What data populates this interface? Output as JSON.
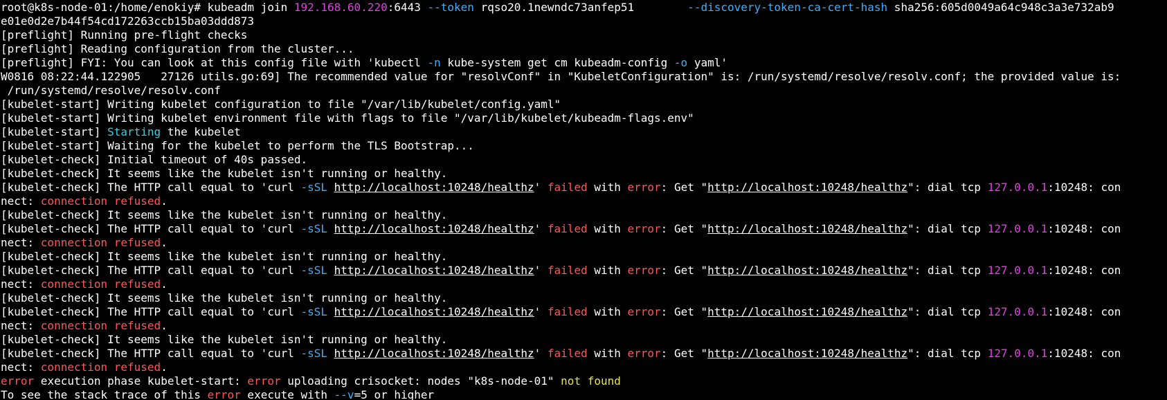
{
  "terminal": {
    "lines": [
      {
        "segs": [
          {
            "t": "root@k8s-node-01:/home/enokiy# kubeadm join ",
            "c": "p"
          },
          {
            "t": "192.168.60.220",
            "c": "m"
          },
          {
            "t": ":6443 ",
            "c": "p"
          },
          {
            "t": "--token",
            "c": "c"
          },
          {
            "t": " rqso20.1newndc73anfep51        ",
            "c": "p"
          },
          {
            "t": "--discovery-token-ca-cert-hash",
            "c": "c"
          },
          {
            "t": " sha256:605d0049a64c948c3a3e732ab9",
            "c": "p"
          }
        ]
      },
      {
        "segs": [
          {
            "t": "e01e0d2e7b44f54cd172263ccb15ba03ddd873",
            "c": "p"
          }
        ]
      },
      {
        "segs": [
          {
            "t": "[preflight] Running pre-flight checks",
            "c": "p"
          }
        ]
      },
      {
        "segs": [
          {
            "t": "[preflight] Reading configuration from the cluster...",
            "c": "p"
          }
        ]
      },
      {
        "segs": [
          {
            "t": "[preflight] FYI: You can look at this config file with 'kubectl ",
            "c": "p"
          },
          {
            "t": "-n",
            "c": "c"
          },
          {
            "t": " kube-system get cm kubeadm-config ",
            "c": "p"
          },
          {
            "t": "-o",
            "c": "c"
          },
          {
            "t": " yaml'",
            "c": "p"
          }
        ]
      },
      {
        "segs": [
          {
            "t": "W0816 08:22:44.122905   27126 utils.go:69] The recommended value for \"resolvConf\" in \"KubeletConfiguration\" is: /run/systemd/resolve/resolv.conf; the provided value is:",
            "c": "p"
          }
        ]
      },
      {
        "segs": [
          {
            "t": " /run/systemd/resolve/resolv.conf",
            "c": "p"
          }
        ]
      },
      {
        "segs": [
          {
            "t": "[kubelet-start] Writing kubelet configuration to file \"/var/lib/kubelet/config.yaml\"",
            "c": "p"
          }
        ]
      },
      {
        "segs": [
          {
            "t": "[kubelet-start] Writing kubelet environment file with flags to file \"/var/lib/kubelet/kubeadm-flags.env\"",
            "c": "p"
          }
        ]
      },
      {
        "segs": [
          {
            "t": "[kubelet-start] ",
            "c": "p"
          },
          {
            "t": "Starting",
            "c": "t"
          },
          {
            "t": " the kubelet",
            "c": "p"
          }
        ]
      },
      {
        "segs": [
          {
            "t": "[kubelet-start] Waiting for the kubelet to perform the TLS Bootstrap...",
            "c": "p"
          }
        ]
      },
      {
        "segs": [
          {
            "t": "[kubelet-check] Initial timeout of 40s passed.",
            "c": "p"
          }
        ]
      },
      {
        "segs": [
          {
            "t": "[kubelet-check] It seems like the kubelet isn't running or healthy.",
            "c": "p"
          }
        ]
      },
      {
        "segs": [
          {
            "t": "[kubelet-check] The HTTP call equal to 'curl ",
            "c": "p"
          },
          {
            "t": "-sSL",
            "c": "c"
          },
          {
            "t": " ",
            "c": "p"
          },
          {
            "t": "http://localhost:10248/healthz",
            "c": "u"
          },
          {
            "t": "' ",
            "c": "p"
          },
          {
            "t": "failed",
            "c": "r"
          },
          {
            "t": " with ",
            "c": "p"
          },
          {
            "t": "error",
            "c": "r"
          },
          {
            "t": ": Get \"",
            "c": "p"
          },
          {
            "t": "http://localhost:10248/healthz",
            "c": "u"
          },
          {
            "t": "\": dial tcp ",
            "c": "p"
          },
          {
            "t": "127.0.0.1",
            "c": "m"
          },
          {
            "t": ":10248: con",
            "c": "p"
          }
        ]
      },
      {
        "segs": [
          {
            "t": "nect: ",
            "c": "p"
          },
          {
            "t": "connection refused",
            "c": "r"
          },
          {
            "t": ".",
            "c": "p"
          }
        ]
      },
      {
        "segs": [
          {
            "t": "[kubelet-check] It seems like the kubelet isn't running or healthy.",
            "c": "p"
          }
        ]
      },
      {
        "segs": [
          {
            "t": "[kubelet-check] The HTTP call equal to 'curl ",
            "c": "p"
          },
          {
            "t": "-sSL",
            "c": "c"
          },
          {
            "t": " ",
            "c": "p"
          },
          {
            "t": "http://localhost:10248/healthz",
            "c": "u"
          },
          {
            "t": "' ",
            "c": "p"
          },
          {
            "t": "failed",
            "c": "r"
          },
          {
            "t": " with ",
            "c": "p"
          },
          {
            "t": "error",
            "c": "r"
          },
          {
            "t": ": Get \"",
            "c": "p"
          },
          {
            "t": "http://localhost:10248/healthz",
            "c": "u"
          },
          {
            "t": "\": dial tcp ",
            "c": "p"
          },
          {
            "t": "127.0.0.1",
            "c": "m"
          },
          {
            "t": ":10248: con",
            "c": "p"
          }
        ]
      },
      {
        "segs": [
          {
            "t": "nect: ",
            "c": "p"
          },
          {
            "t": "connection refused",
            "c": "r"
          },
          {
            "t": ".",
            "c": "p"
          }
        ]
      },
      {
        "segs": [
          {
            "t": "[kubelet-check] It seems like the kubelet isn't running or healthy.",
            "c": "p"
          }
        ]
      },
      {
        "segs": [
          {
            "t": "[kubelet-check] The HTTP call equal to 'curl ",
            "c": "p"
          },
          {
            "t": "-sSL",
            "c": "c"
          },
          {
            "t": " ",
            "c": "p"
          },
          {
            "t": "http://localhost:10248/healthz",
            "c": "u"
          },
          {
            "t": "' ",
            "c": "p"
          },
          {
            "t": "failed",
            "c": "r"
          },
          {
            "t": " with ",
            "c": "p"
          },
          {
            "t": "error",
            "c": "r"
          },
          {
            "t": ": Get \"",
            "c": "p"
          },
          {
            "t": "http://localhost:10248/healthz",
            "c": "u"
          },
          {
            "t": "\": dial tcp ",
            "c": "p"
          },
          {
            "t": "127.0.0.1",
            "c": "m"
          },
          {
            "t": ":10248: con",
            "c": "p"
          }
        ]
      },
      {
        "segs": [
          {
            "t": "nect: ",
            "c": "p"
          },
          {
            "t": "connection refused",
            "c": "r"
          },
          {
            "t": ".",
            "c": "p"
          }
        ]
      },
      {
        "segs": [
          {
            "t": "[kubelet-check] It seems like the kubelet isn't running or healthy.",
            "c": "p"
          }
        ]
      },
      {
        "segs": [
          {
            "t": "[kubelet-check] The HTTP call equal to 'curl ",
            "c": "p"
          },
          {
            "t": "-sSL",
            "c": "c"
          },
          {
            "t": " ",
            "c": "p"
          },
          {
            "t": "http://localhost:10248/healthz",
            "c": "u"
          },
          {
            "t": "' ",
            "c": "p"
          },
          {
            "t": "failed",
            "c": "r"
          },
          {
            "t": " with ",
            "c": "p"
          },
          {
            "t": "error",
            "c": "r"
          },
          {
            "t": ": Get \"",
            "c": "p"
          },
          {
            "t": "http://localhost:10248/healthz",
            "c": "u"
          },
          {
            "t": "\": dial tcp ",
            "c": "p"
          },
          {
            "t": "127.0.0.1",
            "c": "m"
          },
          {
            "t": ":10248: con",
            "c": "p"
          }
        ]
      },
      {
        "segs": [
          {
            "t": "nect: ",
            "c": "p"
          },
          {
            "t": "connection refused",
            "c": "r"
          },
          {
            "t": ".",
            "c": "p"
          }
        ]
      },
      {
        "segs": [
          {
            "t": "[kubelet-check] It seems like the kubelet isn't running or healthy.",
            "c": "p"
          }
        ]
      },
      {
        "segs": [
          {
            "t": "[kubelet-check] The HTTP call equal to 'curl ",
            "c": "p"
          },
          {
            "t": "-sSL",
            "c": "c"
          },
          {
            "t": " ",
            "c": "p"
          },
          {
            "t": "http://localhost:10248/healthz",
            "c": "u"
          },
          {
            "t": "' ",
            "c": "p"
          },
          {
            "t": "failed",
            "c": "r"
          },
          {
            "t": " with ",
            "c": "p"
          },
          {
            "t": "error",
            "c": "r"
          },
          {
            "t": ": Get \"",
            "c": "p"
          },
          {
            "t": "http://localhost:10248/healthz",
            "c": "u"
          },
          {
            "t": "\": dial tcp ",
            "c": "p"
          },
          {
            "t": "127.0.0.1",
            "c": "m"
          },
          {
            "t": ":10248: con",
            "c": "p"
          }
        ]
      },
      {
        "segs": [
          {
            "t": "nect: ",
            "c": "p"
          },
          {
            "t": "connection refused",
            "c": "r"
          },
          {
            "t": ".",
            "c": "p"
          }
        ]
      },
      {
        "segs": [
          {
            "t": "error",
            "c": "r"
          },
          {
            "t": " execution phase kubelet-start: ",
            "c": "p"
          },
          {
            "t": "error",
            "c": "r"
          },
          {
            "t": " uploading crisocket: nodes \"k8s-node-01\" ",
            "c": "p"
          },
          {
            "t": "not found",
            "c": "y"
          }
        ]
      },
      {
        "segs": [
          {
            "t": "To see the stack trace of this ",
            "c": "p"
          },
          {
            "t": "error",
            "c": "r"
          },
          {
            "t": " execute with ",
            "c": "p"
          },
          {
            "t": "--v",
            "c": "c"
          },
          {
            "t": "=5 or higher",
            "c": "p"
          }
        ]
      }
    ]
  }
}
